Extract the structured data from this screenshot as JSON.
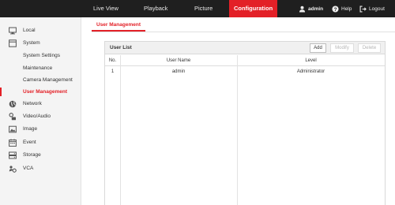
{
  "topnav": {
    "tabs": [
      "Live View",
      "Playback",
      "Picture",
      "Configuration"
    ],
    "active": "Configuration",
    "user": "admin",
    "help": "Help",
    "logout": "Logout"
  },
  "sidebar": {
    "items": [
      {
        "label": "Local",
        "icon": "monitor-icon"
      },
      {
        "label": "System",
        "icon": "system-icon"
      },
      {
        "label": "System Settings"
      },
      {
        "label": "Maintenance"
      },
      {
        "label": "Camera Management"
      },
      {
        "label": "User Management"
      },
      {
        "label": "Network",
        "icon": "globe-icon"
      },
      {
        "label": "Video/Audio",
        "icon": "video-audio-icon"
      },
      {
        "label": "Image",
        "icon": "image-icon"
      },
      {
        "label": "Event",
        "icon": "calendar-icon"
      },
      {
        "label": "Storage",
        "icon": "storage-icon"
      },
      {
        "label": "VCA",
        "icon": "vca-icon"
      }
    ],
    "active": "User Management"
  },
  "page": {
    "tab": "User Management",
    "panel_title": "User List",
    "buttons": {
      "add": "Add",
      "modify": "Modify",
      "delete": "Delete"
    },
    "columns": [
      "No.",
      "User Name",
      "Level"
    ],
    "rows": [
      {
        "no": "1",
        "user": "admin",
        "level": "Administrator"
      }
    ]
  },
  "colors": {
    "accent": "#e32027",
    "topbar": "#1f1f1f"
  }
}
